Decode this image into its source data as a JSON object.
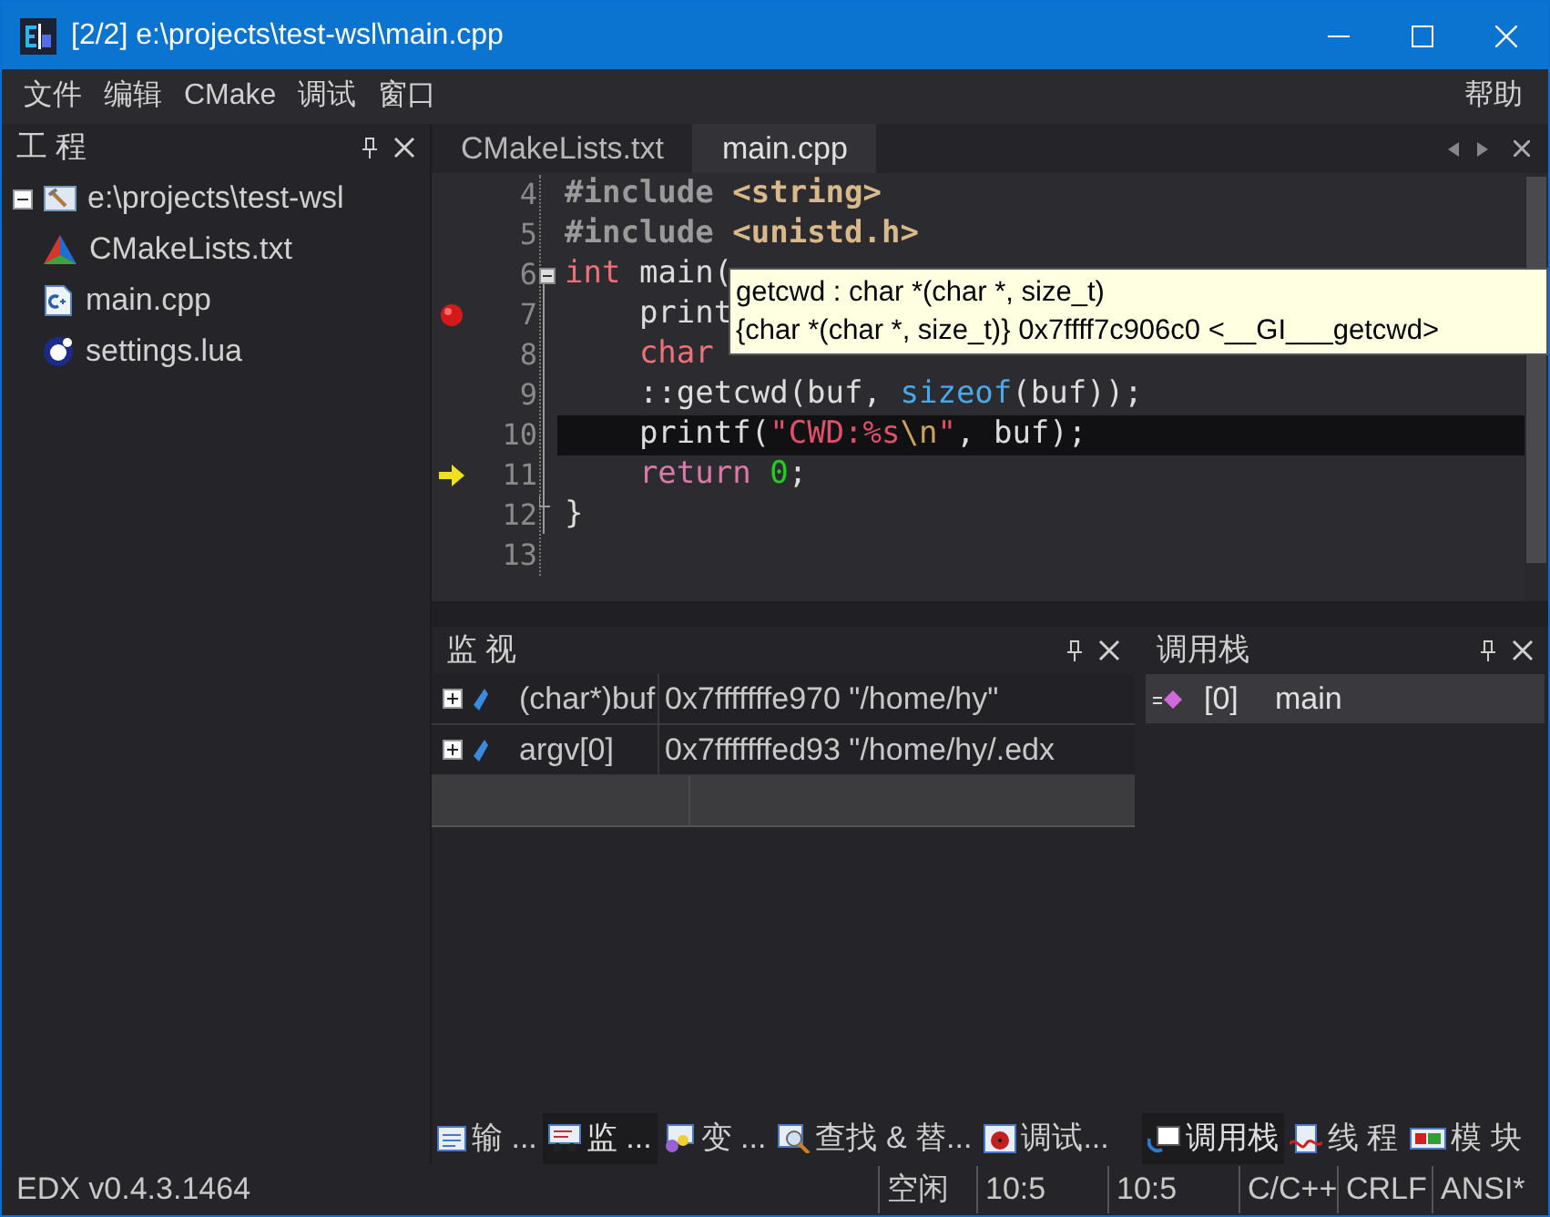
{
  "window": {
    "title": "[2/2] e:\\projects\\test-wsl\\main.cpp"
  },
  "menu": [
    "文件",
    "编辑",
    "CMake",
    "调试",
    "窗口"
  ],
  "menu_right": "帮助",
  "project_panel": {
    "title": "工 程",
    "tree": [
      {
        "label": "e:\\projects\\test-wsl",
        "kind": "project",
        "expanded": true,
        "children": [
          {
            "label": "CMakeLists.txt",
            "kind": "cmake"
          },
          {
            "label": "main.cpp",
            "kind": "cpp"
          },
          {
            "label": "settings.lua",
            "kind": "lua"
          }
        ]
      }
    ]
  },
  "editor": {
    "tabs": [
      {
        "label": "CMakeLists.txt",
        "selected": false
      },
      {
        "label": "main.cpp",
        "selected": true
      }
    ],
    "lines": [
      {
        "number": "4",
        "breakpoint": false,
        "execution_point": false,
        "fold_start": false,
        "fold_end": false,
        "current": false,
        "tokens": [
          {
            "kind": "preproc",
            "text": "#include "
          },
          {
            "kind": "header",
            "text": "<string>"
          }
        ]
      },
      {
        "number": "5",
        "breakpoint": false,
        "execution_point": false,
        "fold_start": false,
        "fold_end": false,
        "current": false,
        "tokens": [
          {
            "kind": "preproc",
            "text": "#include "
          },
          {
            "kind": "header",
            "text": "<unistd.h>"
          }
        ]
      },
      {
        "number": "6",
        "breakpoint": false,
        "execution_point": false,
        "fold_start": true,
        "fold_end": false,
        "current": false,
        "tokens": [
          {
            "kind": "type",
            "text": "int"
          },
          {
            "kind": "plain",
            "text": " main("
          }
        ]
      },
      {
        "number": "7",
        "breakpoint": true,
        "execution_point": false,
        "fold_start": false,
        "fold_end": false,
        "current": false,
        "tokens": [
          {
            "kind": "plain",
            "text": "    print"
          }
        ]
      },
      {
        "number": "8",
        "breakpoint": false,
        "execution_point": false,
        "fold_start": false,
        "fold_end": false,
        "current": false,
        "tokens": [
          {
            "kind": "type",
            "text": "    char"
          }
        ]
      },
      {
        "number": "9",
        "breakpoint": false,
        "execution_point": false,
        "fold_start": false,
        "fold_end": false,
        "current": false,
        "tokens": [
          {
            "kind": "plain",
            "text": "    ::getcwd(buf, "
          },
          {
            "kind": "builtin",
            "text": "sizeof"
          },
          {
            "kind": "plain",
            "text": "(buf));"
          }
        ]
      },
      {
        "number": "10",
        "breakpoint": false,
        "execution_point": false,
        "fold_start": false,
        "fold_end": false,
        "current": true,
        "tokens": [
          {
            "kind": "plain",
            "text": "    printf("
          },
          {
            "kind": "string",
            "text": "\"CWD:%s"
          },
          {
            "kind": "escape",
            "text": "\\n"
          },
          {
            "kind": "string",
            "text": "\""
          },
          {
            "kind": "plain",
            "text": ", buf);"
          }
        ]
      },
      {
        "number": "11",
        "breakpoint": false,
        "execution_point": true,
        "fold_start": false,
        "fold_end": false,
        "current": false,
        "tokens": [
          {
            "kind": "keyword",
            "text": "    return "
          },
          {
            "kind": "number",
            "text": "0"
          },
          {
            "kind": "plain",
            "text": ";"
          }
        ]
      },
      {
        "number": "12",
        "breakpoint": false,
        "execution_point": false,
        "fold_start": false,
        "fold_end": true,
        "current": false,
        "tokens": [
          {
            "kind": "plain",
            "text": "}"
          }
        ]
      },
      {
        "number": "13",
        "breakpoint": false,
        "execution_point": false,
        "fold_start": false,
        "fold_end": false,
        "current": false
      }
    ],
    "tooltip": [
      "getcwd : char *(char *, size_t)",
      "{char *(char *, size_t)} 0x7ffff7c906c0 <__GI___getcwd>"
    ]
  },
  "watch": {
    "title": "监 视",
    "rows": [
      {
        "name": "(char*)buf",
        "value": "0x7fffffffe970 \"/home/hy\""
      },
      {
        "name": "argv[0]",
        "value": "0x7fffffffed93 \"/home/hy/.edx"
      }
    ]
  },
  "call_stack": {
    "title": "调用栈",
    "rows": [
      {
        "level": "[0]",
        "function": "main",
        "selected": true
      }
    ]
  },
  "bottom_tabs": [
    {
      "label": "输 ...",
      "kind": "output",
      "selected": false
    },
    {
      "label": "监 ...",
      "kind": "watch",
      "selected": true
    },
    {
      "label": "变 ...",
      "kind": "variables",
      "selected": false
    },
    {
      "label": "查找 & 替...",
      "kind": "find",
      "selected": false
    },
    {
      "label": "调试...",
      "kind": "debug",
      "selected": false
    }
  ],
  "right_tabs": [
    {
      "label": "调用栈",
      "kind": "callstack",
      "selected": true
    },
    {
      "label": "线 程",
      "kind": "threads",
      "selected": false
    },
    {
      "label": "模 块",
      "kind": "modules",
      "selected": false
    }
  ],
  "status_bar": {
    "version": "EDX v0.4.3.1464",
    "fields": [
      "空闲",
      "10:5",
      "10:5",
      "C/C++",
      "CRLF",
      "ANSI*"
    ]
  }
}
